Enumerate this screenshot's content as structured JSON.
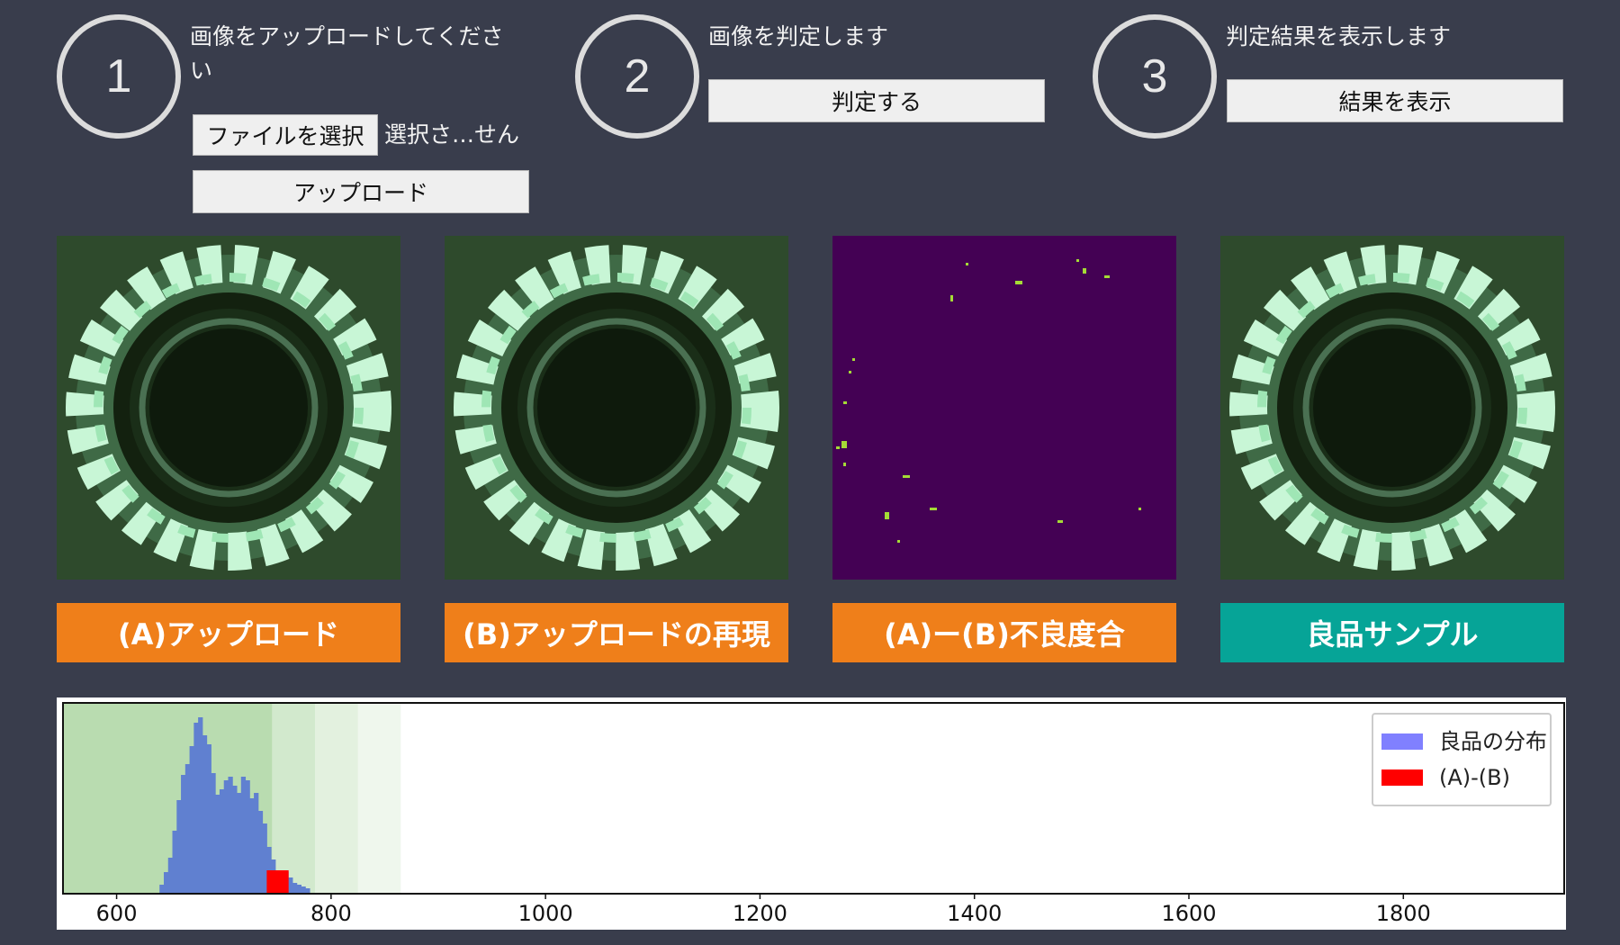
{
  "steps": [
    {
      "number": "1",
      "text": "画像をアップロードしてください",
      "select_button": "ファイルを選択",
      "file_status": "選択さ…せん",
      "upload_button": "アップロード"
    },
    {
      "number": "2",
      "text": "画像を判定します",
      "button": "判定する"
    },
    {
      "number": "3",
      "text": "判定結果を表示します",
      "button": "結果を表示"
    }
  ],
  "panels": [
    {
      "label": "(A)アップロード",
      "color": "#ef7f1a"
    },
    {
      "label": "(B)アップロードの再現",
      "color": "#ef7f1a"
    },
    {
      "label": "(A)ー(B)不良度合",
      "color": "#ef7f1a"
    },
    {
      "label": "良品サンプル",
      "color": "#06a497"
    }
  ],
  "chart_data": {
    "type": "bar",
    "legend": {
      "position": "top-right",
      "entries": [
        {
          "name": "良品の分布",
          "color": "#8080ff"
        },
        {
          "name": "(A)-(B)",
          "color": "#ff0000"
        }
      ]
    },
    "xlim": [
      550,
      1950
    ],
    "xticks": [
      600,
      800,
      1000,
      1200,
      1400,
      1600,
      1800
    ],
    "bands": [
      {
        "from": 550,
        "to": 745,
        "opacity": 0.55
      },
      {
        "from": 745,
        "to": 785,
        "opacity": 0.35
      },
      {
        "from": 785,
        "to": 825,
        "opacity": 0.22
      },
      {
        "from": 825,
        "to": 865,
        "opacity": 0.12
      }
    ],
    "bin_width": 4,
    "series": [
      {
        "name": "良品の分布",
        "color": "#6080d0",
        "bins": [
          [
            640,
            5
          ],
          [
            644,
            12
          ],
          [
            648,
            20
          ],
          [
            652,
            35
          ],
          [
            656,
            52
          ],
          [
            660,
            66
          ],
          [
            664,
            72
          ],
          [
            668,
            82
          ],
          [
            672,
            95
          ],
          [
            676,
            98
          ],
          [
            680,
            88
          ],
          [
            684,
            83
          ],
          [
            688,
            67
          ],
          [
            692,
            55
          ],
          [
            696,
            58
          ],
          [
            700,
            63
          ],
          [
            704,
            65
          ],
          [
            708,
            60
          ],
          [
            712,
            56
          ],
          [
            716,
            65
          ],
          [
            720,
            63
          ],
          [
            724,
            53
          ],
          [
            728,
            56
          ],
          [
            732,
            46
          ],
          [
            736,
            39
          ],
          [
            740,
            26
          ],
          [
            744,
            19
          ],
          [
            748,
            13
          ],
          [
            752,
            10
          ],
          [
            756,
            12
          ],
          [
            760,
            9
          ],
          [
            764,
            6
          ],
          [
            768,
            5
          ],
          [
            772,
            4
          ],
          [
            776,
            3
          ]
        ]
      },
      {
        "name": "(A)-(B)",
        "color": "#ff0000",
        "bins": [
          [
            740,
            13
          ]
        ]
      }
    ]
  }
}
